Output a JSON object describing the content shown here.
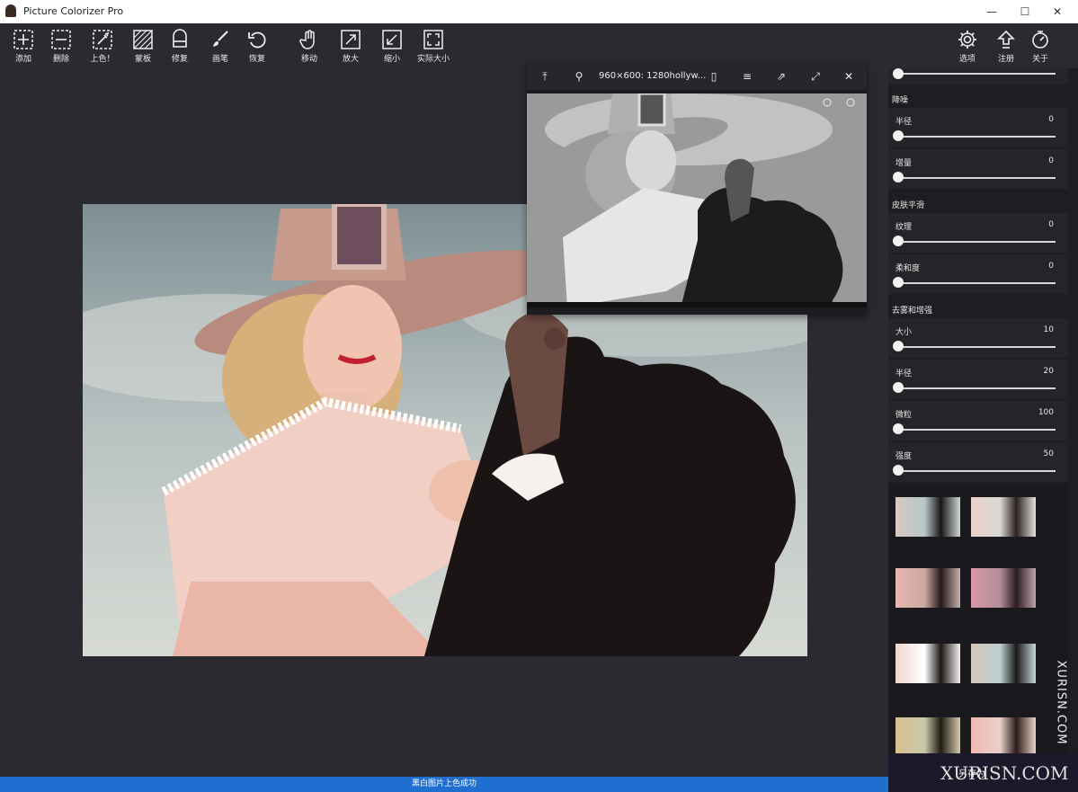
{
  "app": {
    "title": "Picture Colorizer Pro"
  },
  "window_controls": {
    "minimize": "—",
    "maximize": "☐",
    "close": "✕"
  },
  "toolbar": {
    "add": "添加",
    "delete": "删除",
    "colorize": "上色！",
    "mask": "蒙板",
    "repair": "修复",
    "brush": "画笔",
    "restore": "恢复",
    "move": "移动",
    "zoom_in": "放大",
    "zoom_out": "缩小",
    "actual_size": "实际大小",
    "options": "选项",
    "register": "注册",
    "about": "关于"
  },
  "preview": {
    "title": "960×600: 1280hollyw..."
  },
  "panel": {
    "sections": {
      "denoise": "降噪",
      "skin": "皮肤平滑",
      "dehaze": "去雾和增强"
    },
    "sliders": {
      "denoise_radius": {
        "label": "半径",
        "value": "0"
      },
      "denoise_amount": {
        "label": "增量",
        "value": "0"
      },
      "skin_texture": {
        "label": "纹理",
        "value": "0"
      },
      "skin_softness": {
        "label": "柔和度",
        "value": "0"
      },
      "dehaze_size": {
        "label": "大小",
        "value": "10"
      },
      "dehaze_radius": {
        "label": "半径",
        "value": "20"
      },
      "dehaze_grain": {
        "label": "微粒",
        "value": "100"
      },
      "dehaze_strength": {
        "label": "强度",
        "value": "50"
      }
    }
  },
  "status": {
    "message": "黑白图片上色成功"
  },
  "watermark": {
    "vertical": "XURISN.COM",
    "bottom": "XURISN.COM",
    "bottom_overlay": "另存为"
  }
}
